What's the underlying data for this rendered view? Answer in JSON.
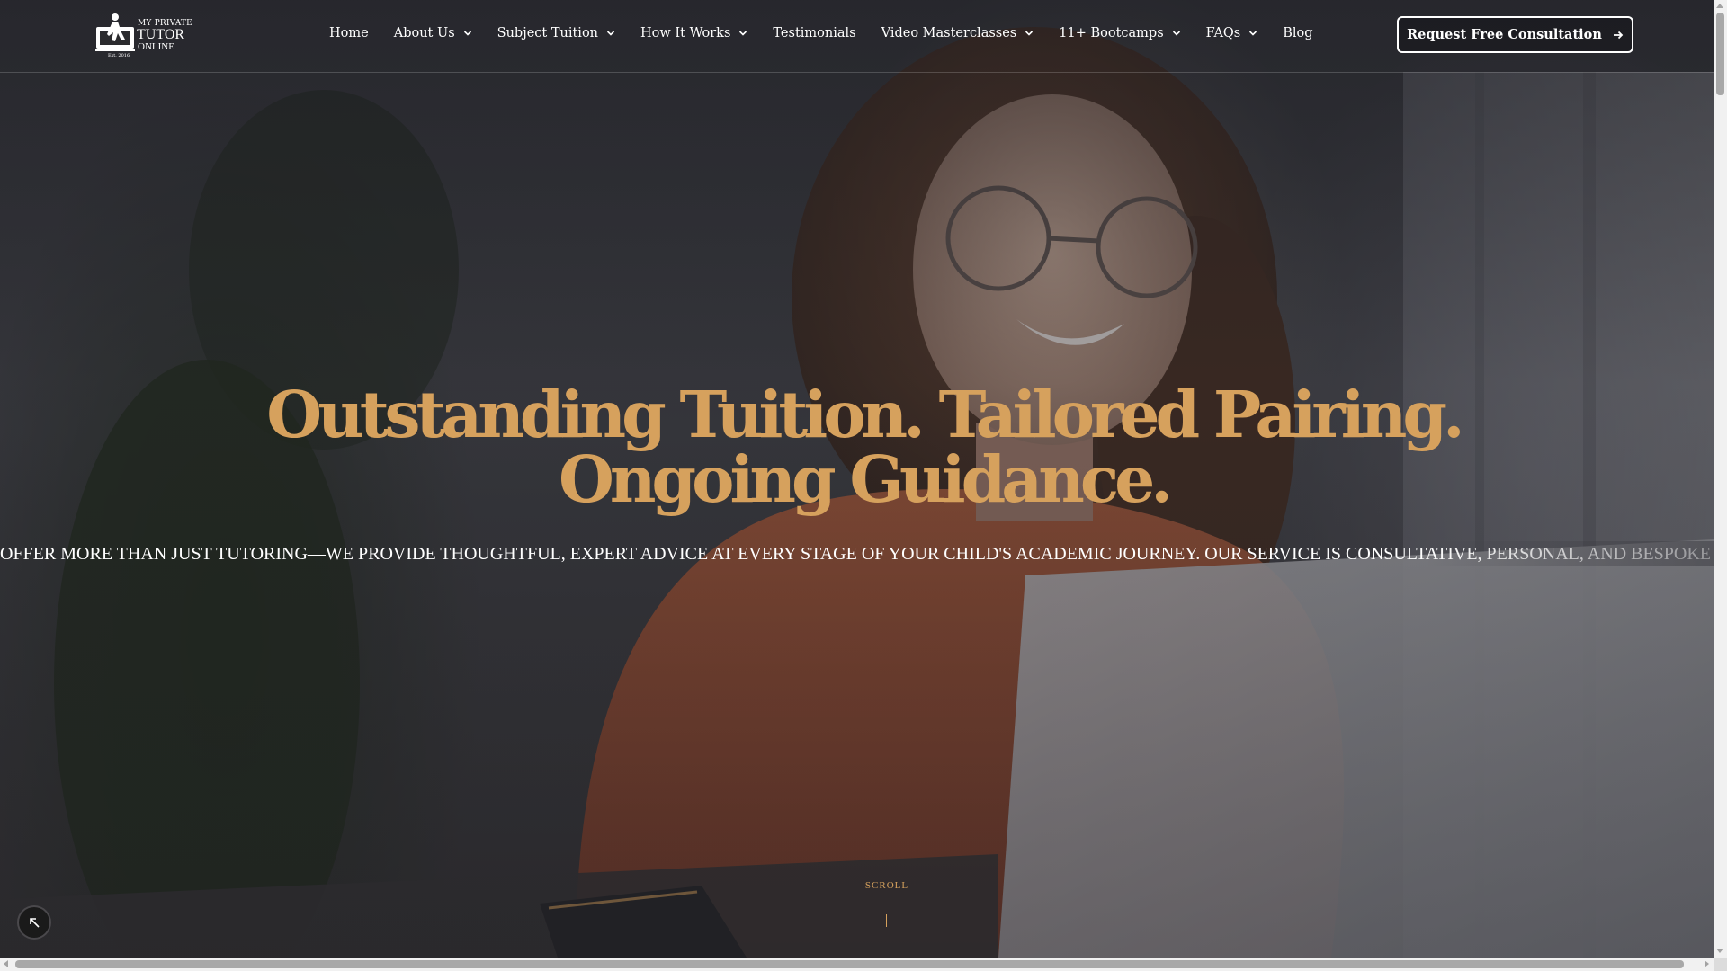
{
  "header": {
    "logo": {
      "line1": "MY PRIVATE",
      "line2": "TUTOR",
      "line3": "ONLINE",
      "established": "Est. 2016"
    },
    "nav": [
      {
        "label": "Home",
        "has_dropdown": false
      },
      {
        "label": "About Us",
        "has_dropdown": true
      },
      {
        "label": "Subject Tuition",
        "has_dropdown": true
      },
      {
        "label": "How It Works",
        "has_dropdown": true
      },
      {
        "label": "Testimonials",
        "has_dropdown": false
      },
      {
        "label": "Video Masterclasses",
        "has_dropdown": true
      },
      {
        "label": "11+ Bootcamps",
        "has_dropdown": true
      },
      {
        "label": "FAQs",
        "has_dropdown": true
      },
      {
        "label": "Blog",
        "has_dropdown": false
      }
    ],
    "cta_label": "Request Free Consultation"
  },
  "hero": {
    "headline_line1": "Outstanding Tuition. Tailored Pairing.",
    "headline_line2": "Ongoing Guidance.",
    "ticker": "OFFER MORE THAN JUST TUTORING—WE PROVIDE THOUGHTFUL, EXPERT ADVICE AT EVERY STAGE OF YOUR CHILD'S ACADEMIC JOURNEY. OUR SERVICE IS CONSULTATIVE, PERSONAL, AND BESPOKE T",
    "scroll_label": "SCROLL"
  },
  "colors": {
    "accent_gold": "#d6a15d",
    "text_white": "#ffffff",
    "header_border": "rgba(255,255,255,0.18)"
  },
  "icons": {
    "dropdown": "chevron-down-icon",
    "cta_arrow": "arrow-right-icon",
    "back_to_top": "arrow-up-left-icon"
  }
}
